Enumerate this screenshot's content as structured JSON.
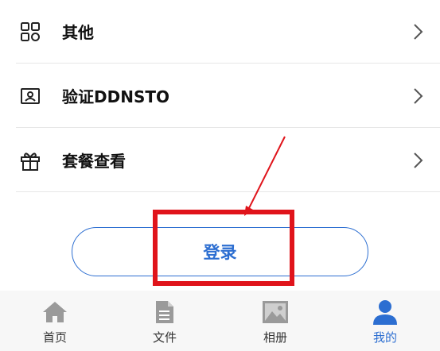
{
  "menu": {
    "items": [
      {
        "label": "其他",
        "icon": "grid-icon"
      },
      {
        "label": "验证DDNSTO",
        "icon": "id-card-icon"
      },
      {
        "label": "套餐查看",
        "icon": "gift-icon"
      }
    ]
  },
  "login": {
    "label": "登录"
  },
  "tabbar": {
    "tabs": [
      {
        "label": "首页",
        "icon": "home-icon",
        "active": false
      },
      {
        "label": "文件",
        "icon": "file-icon",
        "active": false
      },
      {
        "label": "相册",
        "icon": "image-icon",
        "active": false
      },
      {
        "label": "我的",
        "icon": "user-icon",
        "active": true
      }
    ]
  },
  "colors": {
    "accent": "#2c6ed1",
    "annotation": "#e0141b",
    "inactive_icon": "#9a9a9a"
  }
}
